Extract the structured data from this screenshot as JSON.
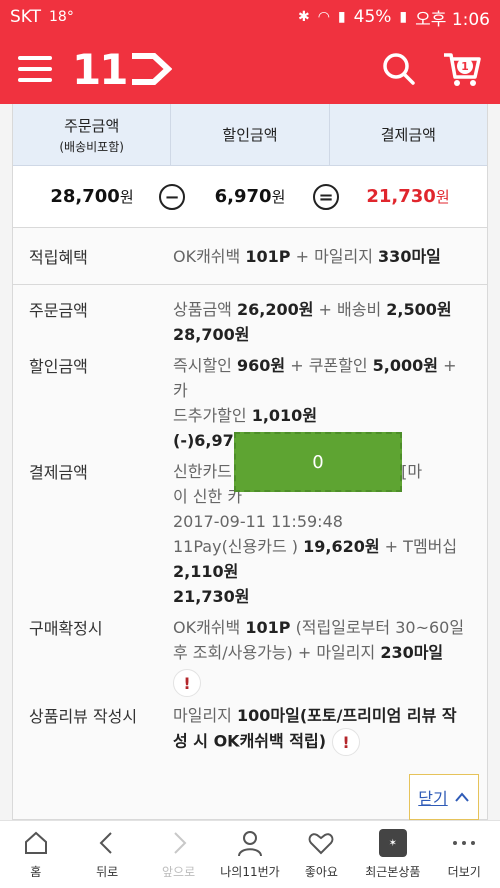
{
  "status": {
    "carrier": "SKT",
    "temp": "18°",
    "battery": "45%",
    "time": "오후 1:06"
  },
  "header": {
    "logo": "11",
    "cart_count": "1"
  },
  "summary": {
    "headers": {
      "order": "주문금액",
      "order_sub": "(배송비포함)",
      "discount": "할인금액",
      "payment": "결제금액"
    },
    "order_amount": "28,700",
    "discount_amount": "6,970",
    "payment_amount": "21,730",
    "won": "원",
    "minus": "−",
    "equals": "="
  },
  "points": {
    "label": "적립혜택",
    "ok": "OK캐쉬백",
    "ok_val": "101P",
    "plus": "+",
    "mile": "마일리지",
    "mile_val": "330마일"
  },
  "details": {
    "order": {
      "label": "주문금액",
      "l1a": "상품금액",
      "l1b": "26,200원",
      "l1c": "+ 배송비",
      "l1d": "2,500원",
      "total": "28,700원"
    },
    "discount": {
      "label": "할인금액",
      "l1a": "즉시할인",
      "l1b": "960원",
      "l1c": "+ 쿠폰할인",
      "l1d": "5,000원",
      "l1e": "+ 카",
      "l2a": "드추가할인",
      "l2b": "1,010원",
      "total": "(-)6,970원"
    },
    "payment": {
      "label": "결제금액",
      "l1a": "신한카드",
      "l1b": "일시불 [마",
      "l2": "이 신한 카",
      "date": "2017-09-11 11:59:48",
      "l4a": "11Pay(신용카드 )",
      "l4b": "19,620원",
      "l4c": "+ T멤버십",
      "l5": "2,110원",
      "total": "21,730원",
      "overlay": "0"
    },
    "confirm": {
      "label": "구매확정시",
      "l1a": "OK캐쉬백",
      "l1b": "101P",
      "l1c": "(적립일로부터 30~60일",
      "l2a": "후 조회/사용가능) + 마일리지",
      "l2b": "230마일",
      "warn": "!"
    },
    "review": {
      "label": "상품리뷰 작성시",
      "l1a": "마일리지",
      "l1b": "100마일(포토/프리미엄 리뷰 작",
      "l2": "성 시 OK캐쉬백 적립)",
      "warn": "!"
    }
  },
  "close_label": "닫기",
  "nav": [
    {
      "label": "홈"
    },
    {
      "label": "뒤로"
    },
    {
      "label": "앞으로"
    },
    {
      "label": "나의11번가"
    },
    {
      "label": "좋아요"
    },
    {
      "label": "최근본상품"
    },
    {
      "label": "더보기"
    }
  ],
  "colors": {
    "brand": "#f0323f",
    "payment_red": "#e0262d",
    "link": "#2f5bb7"
  }
}
